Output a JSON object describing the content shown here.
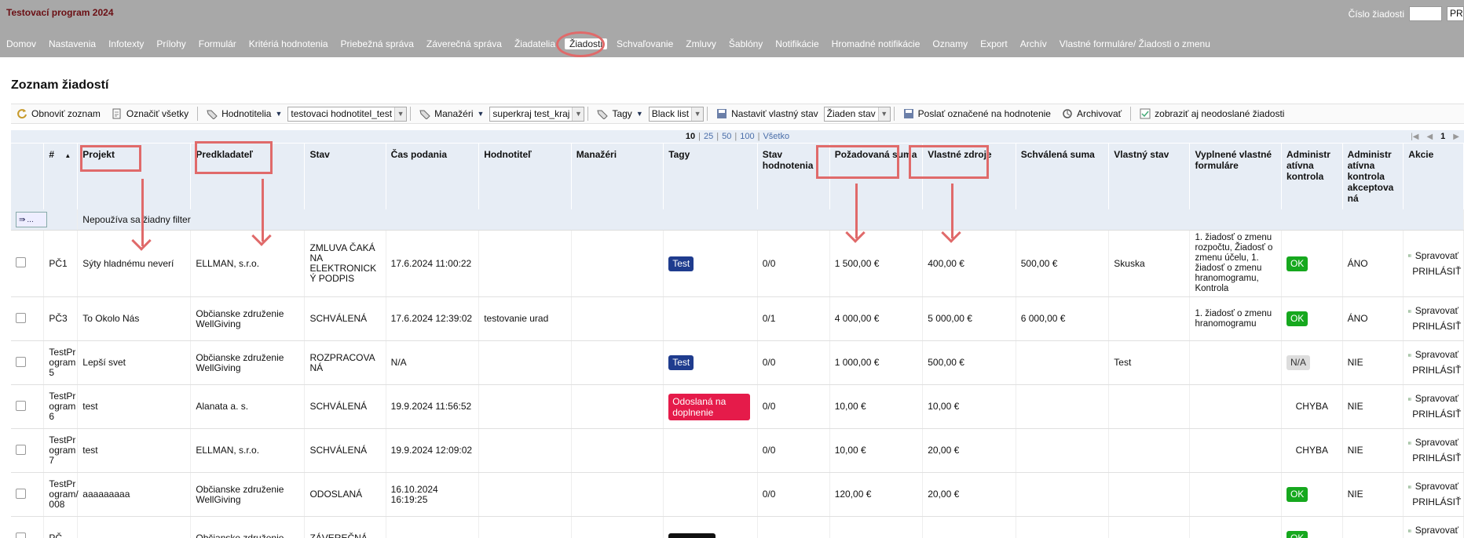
{
  "app": {
    "title": "Testovací program 2024",
    "search_label": "Číslo žiadosti",
    "search_value": "",
    "search_button": "PRI"
  },
  "nav": [
    "Domov",
    "Nastavenia",
    "Infotexty",
    "Prílohy",
    "Formulár",
    "Kritériá hodnotenia",
    "Priebežná správa",
    "Záverečná správa",
    "Žiadatelia",
    "Žiadosti",
    "Schvaľovanie",
    "Zmluvy",
    "Šablóny",
    "Notifikácie",
    "Hromadné notifikácie",
    "Oznamy",
    "Export",
    "Archív",
    "Vlastné formuláre/ Žiadosti o zmenu"
  ],
  "nav_active_index": 9,
  "page": {
    "title": "Zoznam žiadostí"
  },
  "toolbar": {
    "refresh": "Obnoviť zoznam",
    "select_all": "Označiť všetky",
    "evaluators": "Hodnotitelia",
    "evaluator_select": "testovaci hodnotitel_test",
    "managers": "Manažéri",
    "manager_select": "superkraj test_kraj",
    "tags": "Tagy",
    "tag_select": "Black list",
    "set_state": "Nastaviť vlastný stav",
    "state_select": "Žiaden stav",
    "send": "Poslať označené na hodnotenie",
    "archive": "Archivovať",
    "show_unsent": "zobraziť aj neodoslané žiadosti"
  },
  "pager": {
    "sizes": [
      "10",
      "25",
      "50",
      "100",
      "Všetko"
    ],
    "current": "10",
    "page": "1"
  },
  "columns": [
    "#",
    "Projekt",
    "Predkladateľ",
    "Stav",
    "Čas podania",
    "Hodnotiteľ",
    "Manažéri",
    "Tagy",
    "Stav hodnotenia",
    "Požadovaná suma",
    "Vlastné zdroje",
    "Schválená suma",
    "Vlastný stav",
    "Vyplnené vlastné formuláre",
    "Administratívna kontrola",
    "Administratívna kontrola akceptovaná",
    "Akcie"
  ],
  "columns_display": {
    "admin_check": "Administr atívna kontrola",
    "admin_accept": "Administr atívna kontrola akceptova ná",
    "eval_state": "Stav hodnotenia",
    "req_sum": "Požadovaná suma"
  },
  "filter_text": "Nepoužíva sa žiadny filter",
  "filter_btn": "...",
  "actions": {
    "manage": "Spravovať",
    "login": "PRIHLÁSIŤ"
  },
  "rows": [
    {
      "id": "PČ1",
      "project": "Sýty hladnému neverí",
      "applicant": "ELLMAN, s.r.o.",
      "state": "ZMLUVA ČAKÁ NA ELEKTRONICK Ý PODPIS",
      "time": "17.6.2024 11:00:22",
      "evaluator": "",
      "managers": "",
      "tag": "Test",
      "tag_color": "#1f3c8e",
      "eval_state": "0/0",
      "req": "1 500,00 €",
      "own": "400,00 €",
      "approved": "500,00 €",
      "own_state": "Skuska",
      "forms": "1. žiadosť o zmenu rozpočtu, Žiadosť o zmenu účelu, 1. žiadosť o zmenu hranomogramu, Kontrola",
      "admin": "OK",
      "accepted": "ÁNO"
    },
    {
      "id": "PČ3",
      "project": "To Okolo Nás",
      "applicant": "Občianske združenie WellGiving",
      "state": "SCHVÁLENÁ",
      "time": "17.6.2024 12:39:02",
      "evaluator": "testovanie urad",
      "managers": "",
      "tag": "",
      "tag_color": "",
      "eval_state": "0/1",
      "req": "4 000,00 €",
      "own": "5 000,00 €",
      "approved": "6 000,00 €",
      "own_state": "",
      "forms": "1. žiadosť o zmenu hranomogramu",
      "admin": "OK",
      "accepted": "ÁNO"
    },
    {
      "id": "TestProgram 5",
      "project": "Lepší svet",
      "applicant": "Občianske združenie WellGiving",
      "state": "ROZPRACOVA NÁ",
      "time": "N/A",
      "evaluator": "",
      "managers": "",
      "tag": "Test",
      "tag_color": "#1f3c8e",
      "eval_state": "0/0",
      "req": "1 000,00 €",
      "own": "500,00 €",
      "approved": "",
      "own_state": "Test",
      "forms": "",
      "admin": "N/A",
      "accepted": "NIE"
    },
    {
      "id": "TestProgram 6",
      "project": "test",
      "applicant": "Alanata a. s.",
      "state": "SCHVÁLENÁ",
      "time": "19.9.2024 11:56:52",
      "evaluator": "",
      "managers": "",
      "tag": "Odoslaná na doplnenie",
      "tag_color": "#e51b4a",
      "eval_state": "0/0",
      "req": "10,00 €",
      "own": "10,00 €",
      "approved": "",
      "own_state": "",
      "forms": "",
      "admin": "CHYBA",
      "accepted": "NIE"
    },
    {
      "id": "TestProgram 7",
      "project": "test",
      "applicant": "ELLMAN, s.r.o.",
      "state": "SCHVÁLENÁ",
      "time": "19.9.2024 12:09:02",
      "evaluator": "",
      "managers": "",
      "tag": "",
      "tag_color": "",
      "eval_state": "0/0",
      "req": "10,00 €",
      "own": "20,00 €",
      "approved": "",
      "own_state": "",
      "forms": "",
      "admin": "CHYBA",
      "accepted": "NIE"
    },
    {
      "id": "TestProgram/008",
      "project": "aaaaaaaaa",
      "applicant": "Občianske združenie WellGiving",
      "state": "ODOSLANÁ",
      "time": "16.10.2024 16:19:25",
      "evaluator": "",
      "managers": "",
      "tag": "",
      "tag_color": "",
      "eval_state": "0/0",
      "req": "120,00 €",
      "own": "20,00 €",
      "approved": "",
      "own_state": "",
      "forms": "",
      "admin": "OK",
      "accepted": "NIE"
    },
    {
      "id": "",
      "project": "",
      "applicant": "Občianske združenie",
      "state": "ZÁVEREČNÁ",
      "time": "",
      "evaluator": "",
      "managers": "",
      "tag": "",
      "tag_color": "#111",
      "eval_state": "",
      "req": "",
      "own": "",
      "approved": "",
      "own_state": "",
      "forms": "",
      "admin": "OK",
      "accepted": ""
    }
  ],
  "row_ids_display": [
    "PČ1",
    "PČ3",
    "TestPr ogram 5",
    "TestPr ogram 6",
    "TestPr ogram 7",
    "TestPr ogram/ 008",
    "PČ"
  ],
  "row_states_display": [
    "ZMLUVA ČAKÁ NA ELEKTRONICK Ý PODPIS",
    "SCHVÁLENÁ",
    "ROZPRACOVA NÁ",
    "SCHVÁLENÁ",
    "SCHVÁLENÁ",
    "ODOSLANÁ",
    "ZÁVEREČNÁ"
  ],
  "colors": {
    "topbar": "#a8a8a8",
    "title": "#6b0f14",
    "highlight": "#e06a6a",
    "header_bg": "#e7edf5",
    "ok": "#16a81e",
    "tag_blue": "#1f3c8e",
    "tag_red": "#e51b4a"
  }
}
